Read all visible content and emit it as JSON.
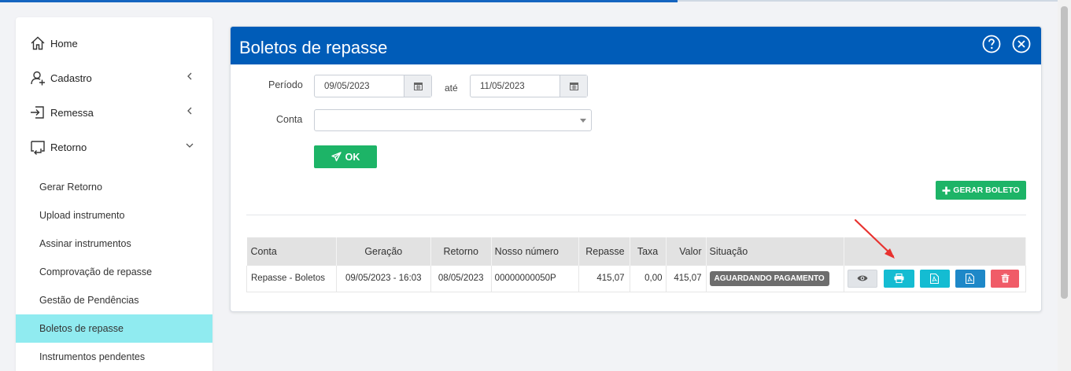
{
  "sidebar": {
    "items": [
      {
        "label": "Home",
        "icon": "home-icon"
      },
      {
        "label": "Cadastro",
        "icon": "user-add-icon"
      },
      {
        "label": "Remessa",
        "icon": "sign-in-icon"
      },
      {
        "label": "Retorno",
        "icon": "return-icon"
      }
    ],
    "subitems": [
      "Gerar Retorno",
      "Upload instrumento",
      "Assinar instrumentos",
      "Comprovação de repasse",
      "Gestão de Pendências",
      "Boletos de repasse",
      "Instrumentos pendentes"
    ],
    "active_subitem": "Boletos de repasse"
  },
  "panel": {
    "title": "Boletos de repasse",
    "header_icons": [
      "help-icon",
      "close-icon"
    ]
  },
  "form": {
    "periodo_label": "Período",
    "date_from": "09/05/2023",
    "ate_label": "até",
    "date_to": "11/05/2023",
    "conta_label": "Conta",
    "conta_value": "",
    "ok_label": "OK",
    "gerar_label": "GERAR BOLETO"
  },
  "table": {
    "headers": [
      "Conta",
      "Geração",
      "Retorno",
      "Nosso número",
      "Repasse",
      "Taxa",
      "Valor",
      "Situação",
      ""
    ],
    "rows": [
      {
        "conta": "Repasse - Boletos",
        "geracao": "09/05/2023 - 16:03",
        "retorno": "08/05/2023",
        "nosso_numero": "00000000050P",
        "repasse": "415,07",
        "taxa": "0,00",
        "valor": "415,07",
        "situacao": "AGUARDANDO PAGAMENTO"
      }
    ],
    "actions": [
      "eye-icon",
      "print-icon",
      "pdf-icon",
      "pdf-icon",
      "trash-icon"
    ]
  },
  "colors": {
    "header_blue": "#005cb8",
    "green": "#1db467",
    "teal": "#14bcd2",
    "blue": "#1e88c8",
    "red": "#f05c68",
    "active_bg": "#90ebf0",
    "arrow": "#e8322f"
  }
}
